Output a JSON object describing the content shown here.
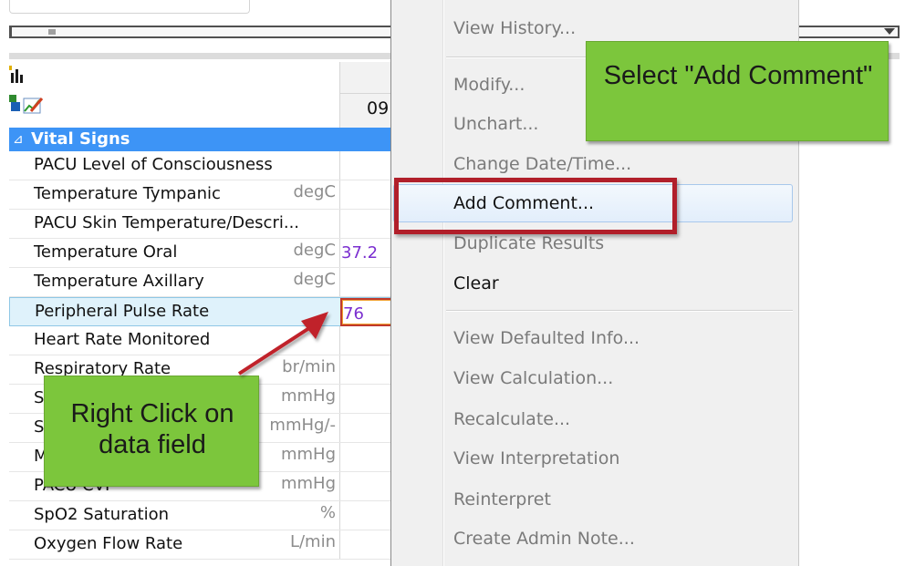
{
  "flowsheet": {
    "time_header": "09",
    "section": "Vital Signs",
    "rows": [
      {
        "name": "PACU Level of Consciousness",
        "unit": "",
        "value": ""
      },
      {
        "name": "Temperature Tympanic",
        "unit": "degC",
        "value": ""
      },
      {
        "name": "PACU Skin Temperature/Descri...",
        "unit": "",
        "value": ""
      },
      {
        "name": "Temperature Oral",
        "unit": "degC",
        "value": "37.2"
      },
      {
        "name": "Temperature Axillary",
        "unit": "degC",
        "value": ""
      },
      {
        "name": "Peripheral Pulse Rate",
        "unit": "",
        "value": "76"
      },
      {
        "name": "Heart Rate Monitored",
        "unit": "",
        "value": ""
      },
      {
        "name": "Respiratory Rate",
        "unit": "br/min",
        "value": ""
      },
      {
        "name": "S",
        "unit": "mmHg",
        "value": ""
      },
      {
        "name": "S",
        "unit": "mmHg/-",
        "value": ""
      },
      {
        "name": "M",
        "unit": "mmHg",
        "value": ""
      },
      {
        "name": "PACU CVP",
        "unit": "mmHg",
        "value": ""
      },
      {
        "name": "SpO2 Saturation",
        "unit": "%",
        "value": ""
      },
      {
        "name": "Oxygen Flow Rate",
        "unit": "L/min",
        "value": ""
      }
    ]
  },
  "context_menu": {
    "view_history": "View History...",
    "modify": "Modify...",
    "unchart": "Unchart...",
    "change_datetime": "Change Date/Time...",
    "add_comment": "Add Comment...",
    "duplicate_results": "Duplicate Results",
    "clear": "Clear",
    "view_defaulted_info": "View Defaulted Info...",
    "view_calculation": "View Calculation...",
    "recalculate": "Recalculate...",
    "view_interpretation": "View Interpretation",
    "reinterpret": "Reinterpret",
    "create_admin_note": "Create Admin Note..."
  },
  "callouts": {
    "left": "Right Click on data field",
    "right": "Select \"Add Comment\""
  },
  "colors": {
    "section_blue": "#3d94f6",
    "callout_green": "#7cc63c",
    "highlight_red": "#b11f2a",
    "value_purple": "#7b2fd0"
  }
}
